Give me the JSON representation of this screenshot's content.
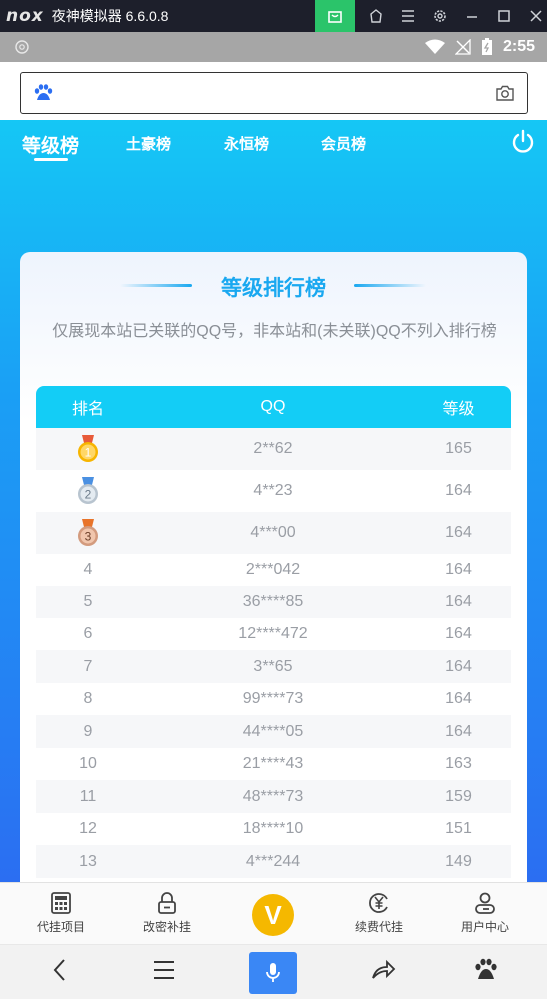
{
  "emulator": {
    "logo": "nox",
    "app_name": "夜神模拟器 6.6.0.8",
    "icons": [
      "shop-icon",
      "home-icon",
      "menu-icon",
      "gear-icon",
      "minimize-icon",
      "maximize-icon",
      "close-icon"
    ]
  },
  "status_bar": {
    "time": "2:55"
  },
  "tabs": [
    {
      "label": "等级榜",
      "active": true
    },
    {
      "label": "土豪榜",
      "active": false
    },
    {
      "label": "永恒榜",
      "active": false
    },
    {
      "label": "会员榜",
      "active": false
    }
  ],
  "card": {
    "title": "等级排行榜",
    "description": "仅展现本站已关联的QQ号，非本站和(未关联)QQ不列入排行榜"
  },
  "table": {
    "headers": [
      "排名",
      "QQ",
      "等级"
    ],
    "rows": [
      {
        "rank": "1",
        "qq": "2**62",
        "level": "165"
      },
      {
        "rank": "2",
        "qq": "4**23",
        "level": "164"
      },
      {
        "rank": "3",
        "qq": "4***00",
        "level": "164"
      },
      {
        "rank": "4",
        "qq": "2***042",
        "level": "164"
      },
      {
        "rank": "5",
        "qq": "36****85",
        "level": "164"
      },
      {
        "rank": "6",
        "qq": "12****472",
        "level": "164"
      },
      {
        "rank": "7",
        "qq": "3**65",
        "level": "164"
      },
      {
        "rank": "8",
        "qq": "99****73",
        "level": "164"
      },
      {
        "rank": "9",
        "qq": "44****05",
        "level": "164"
      },
      {
        "rank": "10",
        "qq": "21****43",
        "level": "163"
      },
      {
        "rank": "11",
        "qq": "48****73",
        "level": "159"
      },
      {
        "rank": "12",
        "qq": "18****10",
        "level": "151"
      },
      {
        "rank": "13",
        "qq": "4***244",
        "level": "149"
      }
    ]
  },
  "bottom_nav": {
    "item1": "代挂项目",
    "item2": "改密补挂",
    "center": "V",
    "item4": "续费代挂",
    "item5": "用户中心"
  },
  "colors": {
    "accent": "#1aa8f0",
    "header": "#13cdf6",
    "gold": "#f5b800",
    "mic": "#3a87f5"
  }
}
